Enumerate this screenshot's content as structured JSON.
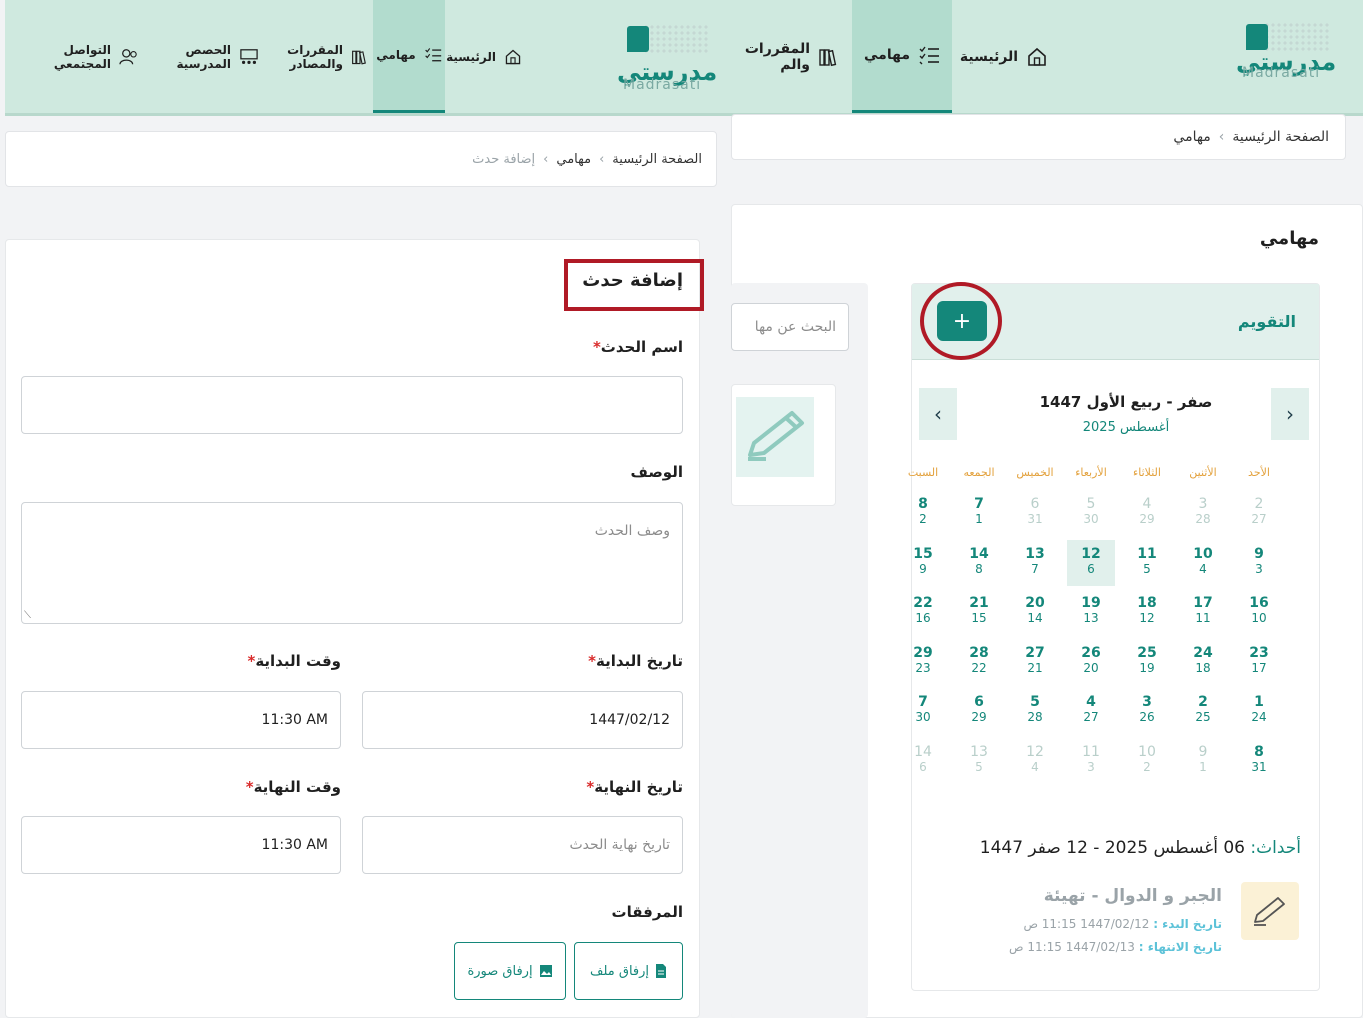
{
  "brand": {
    "name_ar": "مدرستي",
    "name_en": "Madrasati"
  },
  "right": {
    "nav": [
      {
        "label": "الرئيسية",
        "icon": "home-icon"
      },
      {
        "label": "مهامي",
        "icon": "checklist-icon",
        "active": true
      },
      {
        "label": "المقررات والم",
        "icon": "books-icon"
      }
    ],
    "breadcrumb": [
      "الصفحة الرئيسية",
      "مهامي"
    ],
    "page_title": "مهامي",
    "calendar": {
      "title": "التقويم",
      "add_button": "+",
      "hijri_title": "صفر - ربيع الأول 1447",
      "gregorian_title": "أغسطس 2025",
      "weekdays": [
        "الأحد",
        "الأثنين",
        "الثلاثاء",
        "الأربعاء",
        "الخميس",
        "الجمعه",
        "السبت"
      ],
      "weeks": [
        [
          [
            "2",
            "27",
            true
          ],
          [
            "3",
            "28",
            true
          ],
          [
            "4",
            "29",
            true
          ],
          [
            "5",
            "30",
            true
          ],
          [
            "6",
            "31",
            true
          ],
          [
            "7",
            "1",
            false
          ],
          [
            "8",
            "2",
            false
          ]
        ],
        [
          [
            "9",
            "3",
            false
          ],
          [
            "10",
            "4",
            false
          ],
          [
            "11",
            "5",
            false
          ],
          [
            "12",
            "6",
            false,
            true
          ],
          [
            "13",
            "7",
            false
          ],
          [
            "14",
            "8",
            false
          ],
          [
            "15",
            "9",
            false
          ]
        ],
        [
          [
            "16",
            "10",
            false
          ],
          [
            "17",
            "11",
            false
          ],
          [
            "18",
            "12",
            false
          ],
          [
            "19",
            "13",
            false
          ],
          [
            "20",
            "14",
            false
          ],
          [
            "21",
            "15",
            false
          ],
          [
            "22",
            "16",
            false
          ]
        ],
        [
          [
            "23",
            "17",
            false
          ],
          [
            "24",
            "18",
            false
          ],
          [
            "25",
            "19",
            false
          ],
          [
            "26",
            "20",
            false
          ],
          [
            "27",
            "21",
            false
          ],
          [
            "28",
            "22",
            false
          ],
          [
            "29",
            "23",
            false
          ]
        ],
        [
          [
            "1",
            "24",
            false
          ],
          [
            "2",
            "25",
            false
          ],
          [
            "3",
            "26",
            false
          ],
          [
            "4",
            "27",
            false
          ],
          [
            "5",
            "28",
            false
          ],
          [
            "6",
            "29",
            false
          ],
          [
            "7",
            "30",
            false
          ]
        ],
        [
          [
            "8",
            "31",
            false
          ],
          [
            "9",
            "1",
            true
          ],
          [
            "10",
            "2",
            true
          ],
          [
            "11",
            "3",
            true
          ],
          [
            "12",
            "4",
            true
          ],
          [
            "13",
            "5",
            true
          ],
          [
            "14",
            "6",
            true
          ]
        ]
      ],
      "events_label": "أحداث:",
      "events_date": "06 أغسطس 2025 - 12 صفر 1447",
      "event": {
        "title": "الجبر و الدوال - تهيئة",
        "start_label": "تاريخ البدء :",
        "start_value": "1447/02/12 11:15 ص",
        "end_label": "تاريخ الانتهاء :",
        "end_value": "1447/02/13 11:15 ص"
      }
    },
    "search_placeholder": "البحث عن مها"
  },
  "left": {
    "nav": [
      {
        "label": "الرئيسية",
        "icon": "home-icon"
      },
      {
        "label": "مهامي",
        "icon": "checklist-icon",
        "active": true
      },
      {
        "label": "المقررات والمصادر",
        "icon": "books-icon"
      },
      {
        "label": "الحصص المدرسية",
        "icon": "classes-icon"
      },
      {
        "label": "التواصل المجتمعي",
        "icon": "community-icon"
      }
    ],
    "breadcrumb": [
      "الصفحة الرئيسية",
      "مهامي",
      "إضافة حدث"
    ],
    "form": {
      "title": "إضافة حدث",
      "event_name_label": "اسم الحدث",
      "description_label": "الوصف",
      "description_placeholder": "وصف الحدث",
      "start_date_label": "تاريخ البداية",
      "start_date_value": "1447/02/12",
      "start_time_label": "وقت البداية",
      "start_time_value": "11:30 AM",
      "end_date_label": "تاريخ النهاية",
      "end_date_placeholder": "تاريخ نهاية الحدث",
      "end_time_label": "وقت النهاية",
      "end_time_value": "11:30 AM",
      "attachments_label": "المرفقات",
      "attach_file": "إرفاق ملف",
      "attach_image": "إرفاق صورة",
      "required_mark": "*"
    }
  },
  "colors": {
    "brand": "#14877a",
    "nav_bg": "#cfe9df",
    "highlight": "#b01a26",
    "weekday": "#e3a13c"
  }
}
